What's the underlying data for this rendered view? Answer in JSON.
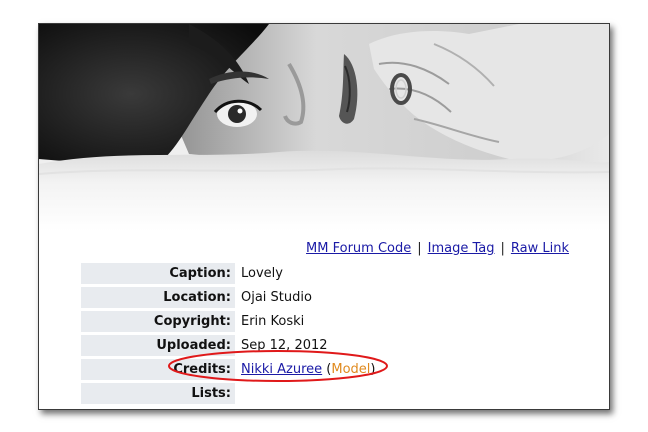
{
  "links": {
    "forum_code": "MM Forum Code",
    "image_tag": "Image Tag",
    "raw_link": "Raw Link",
    "separator": "|"
  },
  "details": {
    "caption_label": "Caption:",
    "caption_value": "Lovely",
    "location_label": "Location:",
    "location_value": "Ojai Studio",
    "copyright_label": "Copyright:",
    "copyright_value": "Erin Koski",
    "uploaded_label": "Uploaded:",
    "uploaded_value": "Sep 12, 2012",
    "credits_label": "Credits:",
    "credits_name": "Nikki Azuree",
    "credits_paren_open": " (",
    "credits_role": "Model",
    "credits_paren_close": ")",
    "lists_label": "Lists:",
    "lists_value": ""
  },
  "colors": {
    "link": "#1a1aa6",
    "role": "#e08a1e",
    "label_bg": "#e8ebef",
    "highlight": "#e0191a"
  }
}
